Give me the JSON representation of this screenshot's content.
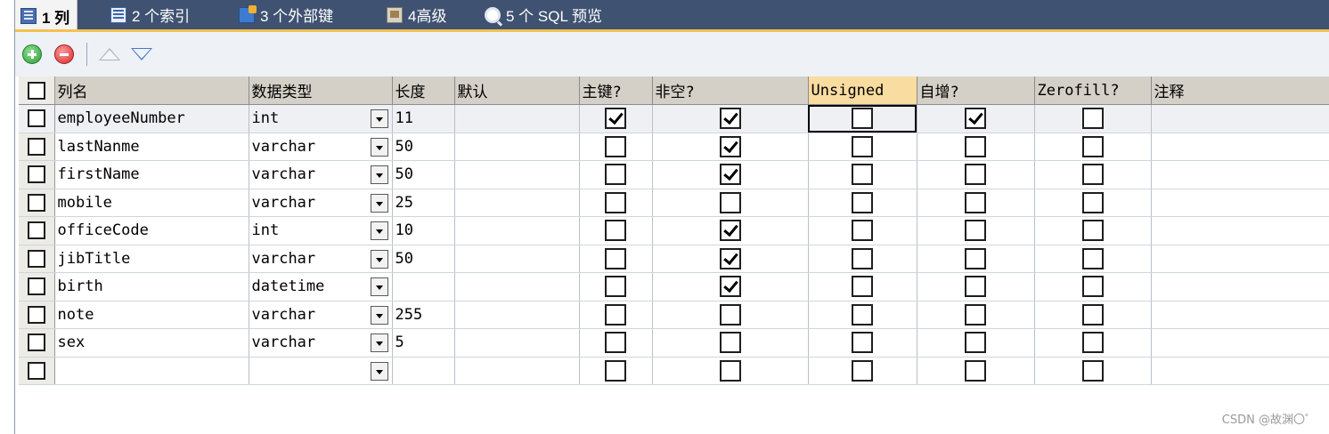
{
  "tabs": [
    {
      "label": "1 列",
      "icon": "columns-table-icon",
      "active": true
    },
    {
      "label": "2 个索引",
      "icon": "index-icon",
      "active": false
    },
    {
      "label": "3 个外部键",
      "icon": "foreign-key-icon",
      "active": false
    },
    {
      "label": "4高级",
      "icon": "advanced-icon",
      "active": false
    },
    {
      "label": "5 个 SQL 预览",
      "icon": "sql-preview-icon",
      "active": false
    }
  ],
  "toolbar": {
    "add_icon": "add-row-icon",
    "delete_icon": "delete-row-icon",
    "up_icon": "move-up-icon",
    "down_icon": "move-down-icon"
  },
  "columns": {
    "name": "列名",
    "type": "数据类型",
    "length": "长度",
    "default": "默认",
    "primary": "主键?",
    "notnull": "非空?",
    "unsigned": "Unsigned",
    "autoinc": "自增?",
    "zerofill": "Zerofill?",
    "comment": "注释"
  },
  "rows": [
    {
      "name": "employeeNumber",
      "type": "int",
      "length": "11",
      "default": "",
      "pk": true,
      "nn": true,
      "unsigned": false,
      "ai": true,
      "zf": false,
      "comment": ""
    },
    {
      "name": "lastNanme",
      "type": "varchar",
      "length": "50",
      "default": "",
      "pk": false,
      "nn": true,
      "unsigned": false,
      "ai": false,
      "zf": false,
      "comment": ""
    },
    {
      "name": "firstName",
      "type": "varchar",
      "length": "50",
      "default": "",
      "pk": false,
      "nn": true,
      "unsigned": false,
      "ai": false,
      "zf": false,
      "comment": ""
    },
    {
      "name": "mobile",
      "type": "varchar",
      "length": "25",
      "default": "",
      "pk": false,
      "nn": false,
      "unsigned": false,
      "ai": false,
      "zf": false,
      "comment": ""
    },
    {
      "name": "officeCode",
      "type": "int",
      "length": "10",
      "default": "",
      "pk": false,
      "nn": true,
      "unsigned": false,
      "ai": false,
      "zf": false,
      "comment": ""
    },
    {
      "name": "jibTitle",
      "type": "varchar",
      "length": "50",
      "default": "",
      "pk": false,
      "nn": true,
      "unsigned": false,
      "ai": false,
      "zf": false,
      "comment": ""
    },
    {
      "name": "birth",
      "type": "datetime",
      "length": "",
      "default": "",
      "pk": false,
      "nn": true,
      "unsigned": false,
      "ai": false,
      "zf": false,
      "comment": ""
    },
    {
      "name": "note",
      "type": "varchar",
      "length": "255",
      "default": "",
      "pk": false,
      "nn": false,
      "unsigned": false,
      "ai": false,
      "zf": false,
      "comment": ""
    },
    {
      "name": "sex",
      "type": "varchar",
      "length": "5",
      "default": "",
      "pk": false,
      "nn": false,
      "unsigned": false,
      "ai": false,
      "zf": false,
      "comment": ""
    },
    {
      "name": "",
      "type": "",
      "length": "",
      "default": "",
      "pk": false,
      "nn": false,
      "unsigned": false,
      "ai": false,
      "zf": false,
      "comment": ""
    }
  ],
  "watermark": "CSDN @故渊〇゜",
  "colors": {
    "tabstrip": "#3f5271",
    "tab_accent": "#f2c150",
    "header_bg": "#d4d0c8",
    "header_highlight": "#f8dca0"
  }
}
